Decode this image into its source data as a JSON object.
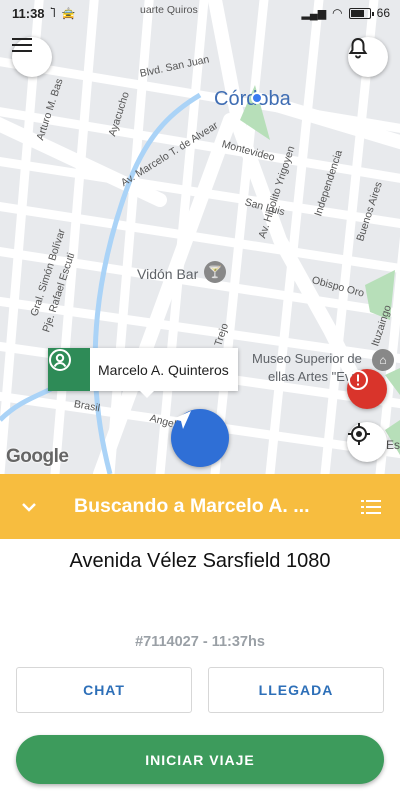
{
  "status_bar": {
    "time": "11:38",
    "battery": "66"
  },
  "map": {
    "city_label": "Córdoba",
    "poi": [
      {
        "name": "Vidón Bar"
      },
      {
        "name": "Museo Superior de Bellas Artes \"Evita\"",
        "line1": "Museo Superior de",
        "line2": "ellas Artes \"Evita\""
      }
    ],
    "streets": [
      "uarte Quiros",
      "Blvd. San Juan",
      "Ayacucho",
      "Av. Marcelo T. de Alvear",
      "Montevideo",
      "San Luis",
      "Av. Hipolito Yrigoyen",
      "Independencia",
      "Buenos Aires",
      "Obispo Oro",
      "Ituzaingo",
      "Arturo M. Bas",
      "Gral. Simón Bolívar",
      "Pje. Rafael Escuti",
      "Trejo",
      "Brasil",
      "Angel",
      "Es"
    ],
    "attribution": "Google",
    "driver_marker": {
      "name": "Marcelo A. Quinteros"
    }
  },
  "banner": {
    "title": "Buscando a Marcelo A. ..."
  },
  "trip": {
    "address": "Avenida Vélez Sarsfield 1080",
    "info": "#7114027 - 11:37hs"
  },
  "buttons": {
    "chat": "CHAT",
    "arrival": "LLEGADA",
    "start_trip": "INICIAR VIAJE"
  },
  "colors": {
    "banner": "#f7bd3f",
    "start_button": "#3d9b5c",
    "navigate_fab": "#2f6fd6",
    "alert_fab": "#d9342b",
    "marker_icon": "#2e8b57",
    "link_text": "#2d6fb8"
  },
  "icons": [
    "menu-icon",
    "bell-icon",
    "navigation-arrow-icon",
    "alert-icon",
    "my-location-icon",
    "chevron-down-icon",
    "list-icon",
    "person-icon"
  ]
}
